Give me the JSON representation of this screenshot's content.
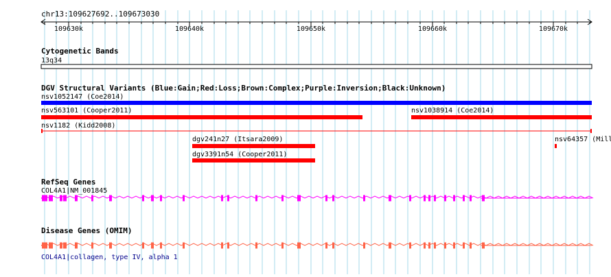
{
  "locus": "chr13:109627692..109673030",
  "ruler": {
    "ticks": [
      "109630k",
      "109640k",
      "109650k",
      "109660k",
      "109670k"
    ]
  },
  "cyto": {
    "title": "Cytogenetic Bands",
    "band": "13q34"
  },
  "dgv": {
    "title": "DGV Structural Variants (Blue:Gain;Red:Loss;Brown:Complex;Purple:Inversion;Black:Unknown)",
    "colors": {
      "gain": "#0000ff",
      "loss": "#ff0000"
    },
    "features": [
      {
        "label": "nsv1052147 (Coe2014)",
        "type": "gain"
      },
      {
        "label": "nsv563101 (Cooper2011)",
        "type": "loss"
      },
      {
        "label": "nsv1038914 (Coe2014)",
        "type": "loss"
      },
      {
        "label": "nsv1182 (Kidd2008)",
        "type": "loss"
      },
      {
        "label": "dgv241n27 (Itsara2009)",
        "type": "loss"
      },
      {
        "label": "dgv3391n54 (Cooper2011)",
        "type": "loss"
      },
      {
        "label": "nsv64357 (Mill",
        "type": "loss"
      }
    ]
  },
  "refseq": {
    "title": "RefSeq Genes",
    "gene_label": "COL4A1|NM_001845",
    "color": "#ff00ff"
  },
  "omim": {
    "title": "Disease Genes (OMIM)",
    "gene_label": "COL4A1|collagen, type IV, alpha 1",
    "color": "#ff6347",
    "label_color": "#00008b"
  },
  "grid_color": "#a6d9e8"
}
